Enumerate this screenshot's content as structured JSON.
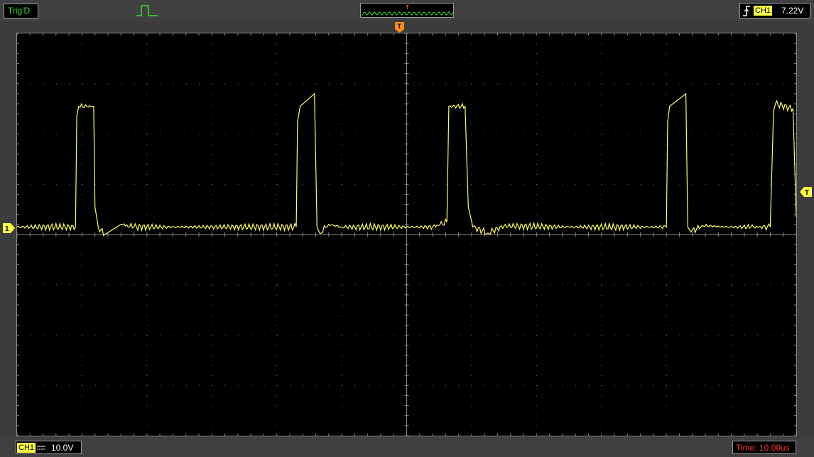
{
  "status": {
    "trigger_state": "Trig'D",
    "memory_trigger_marker": "T"
  },
  "trigger": {
    "channel": "CH1",
    "level": "7.22V",
    "edge": "rising"
  },
  "channel1": {
    "label": "CH1",
    "coupling": "DC",
    "volts_per_div": "10.0V",
    "ground_marker": "1"
  },
  "timebase": {
    "text": "Time: 10.00us"
  },
  "markers": {
    "trigger_position": "T",
    "trigger_level": "T"
  },
  "colors": {
    "trace": "#ffff60",
    "trigger_status": "#31e031",
    "marker_orange": "#ff8c1a",
    "timebase": "#ff3030"
  },
  "chart_data": {
    "type": "line",
    "title": "",
    "xlabel": "",
    "ylabel": "",
    "grid": true,
    "x_divisions": 12,
    "y_divisions": 8,
    "xlim": [
      0,
      12
    ],
    "ylim": [
      -4,
      4
    ],
    "baseline_div": 0,
    "series": [
      {
        "name": "CH1",
        "x": [
          0,
          0.9,
          0.92,
          0.95,
          1.18,
          1.2,
          1.25,
          1.35,
          1.6,
          1.8,
          2.5,
          4.3,
          4.32,
          4.36,
          4.58,
          4.62,
          4.66,
          4.8,
          5.0,
          5.2,
          6.4,
          6.62,
          6.65,
          6.9,
          6.95,
          7.02,
          7.25,
          7.5,
          8.5,
          10.0,
          10.02,
          10.05,
          10.3,
          10.33,
          10.38,
          10.55,
          10.9,
          11.3,
          11.6,
          11.65,
          11.68,
          11.95,
          12.0
        ],
        "y": [
          0.0,
          0.0,
          2.2,
          2.4,
          2.4,
          0.4,
          0.0,
          -0.15,
          0.05,
          0.0,
          0.0,
          0.0,
          2.1,
          2.4,
          2.65,
          0.0,
          -0.12,
          0.05,
          0.0,
          0.0,
          0.0,
          0.1,
          2.4,
          2.4,
          0.4,
          0.0,
          -0.12,
          0.02,
          0.0,
          0.0,
          2.1,
          2.4,
          2.65,
          0.0,
          -0.1,
          0.03,
          0.0,
          0.0,
          0.0,
          2.3,
          2.45,
          2.35,
          0.2
        ]
      }
    ]
  }
}
